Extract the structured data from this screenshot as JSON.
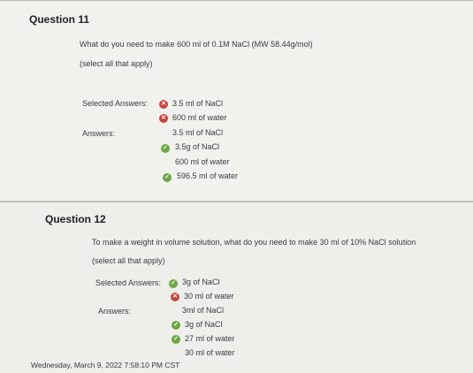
{
  "q11": {
    "title": "Question 11",
    "prompt": "What do you need to make 600 ml of 0.1M NaCl (MW 58.44g/mol)",
    "note": "(select all that apply)",
    "selected_label": "Selected Answers:",
    "selected": [
      "3.5 ml of NaCl",
      "600 ml of water"
    ],
    "answers_label": "Answers:",
    "answers": [
      "3.5 ml of NaCl",
      "3.5g of NaCl",
      "600 ml of water",
      "596.5 ml of water"
    ]
  },
  "q12": {
    "title": "Question 12",
    "prompt": "To make a weight in volume solution, what do you need to make 30 ml of 10% NaCl solution",
    "note": "(select all that apply)",
    "selected_label": "Selected Answers:",
    "selected": [
      "3g of NaCl",
      "30 ml of water"
    ],
    "answers_label": "Answers:",
    "answers": [
      "3ml of NaCl",
      "3g of NaCl",
      "27 ml of water",
      "30 ml of water"
    ]
  },
  "footer": {
    "timestamp": "Wednesday, March 9, 2022 7:58:10 PM CST"
  },
  "colors": {
    "wrong": "#c6463c",
    "right": "#6ea643"
  }
}
